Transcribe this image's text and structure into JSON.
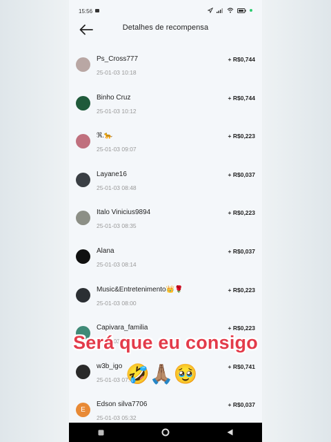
{
  "status_bar": {
    "time": "15:56"
  },
  "header": {
    "title": "Detalhes de recompensa"
  },
  "rewards": [
    {
      "name": "Ps_Cross777",
      "date": "25-01-03 10:18",
      "amount": "+ R$0,744",
      "avatar_color": "#b9a7a4"
    },
    {
      "name": "Binho Cruz",
      "date": "25-01-03 10:12",
      "amount": "+ R$0,744",
      "avatar_color": "#1f5a3a"
    },
    {
      "name": "ℜ.🐆",
      "date": "25-01-03 09:07",
      "amount": "+ R$0,223",
      "avatar_color": "#c0707e"
    },
    {
      "name": "Layane16",
      "date": "25-01-03 08:48",
      "amount": "+ R$0,037",
      "avatar_color": "#3a3f44"
    },
    {
      "name": "Italo Vinicius9894",
      "date": "25-01-03 08:35",
      "amount": "+ R$0,223",
      "avatar_color": "#8c8f86"
    },
    {
      "name": "Alana",
      "date": "25-01-03 08:14",
      "amount": "+ R$0,037",
      "avatar_color": "#101010"
    },
    {
      "name": "Music&Entretenimento👑🌹",
      "date": "25-01-03 08:00",
      "amount": "+ R$0,223",
      "avatar_color": "#2b2f33"
    },
    {
      "name": "Capivara_familia",
      "date": "25-01-03 07:51",
      "amount": "+ R$0,223",
      "avatar_color": "#3f8a77"
    },
    {
      "name": "w3b_igo",
      "date": "25-01-03 07:",
      "amount": "+ R$0,741",
      "avatar_color": "#2a2a2a"
    },
    {
      "name": "Edson silva7706",
      "date": "25-01-03 05:32",
      "amount": "+ R$0,037",
      "avatar_color": "#e88a36",
      "avatar_letter": "E"
    }
  ],
  "overlay": {
    "caption": "Será que eu consigo",
    "emojis": "🤣🙏🏽🥹"
  }
}
